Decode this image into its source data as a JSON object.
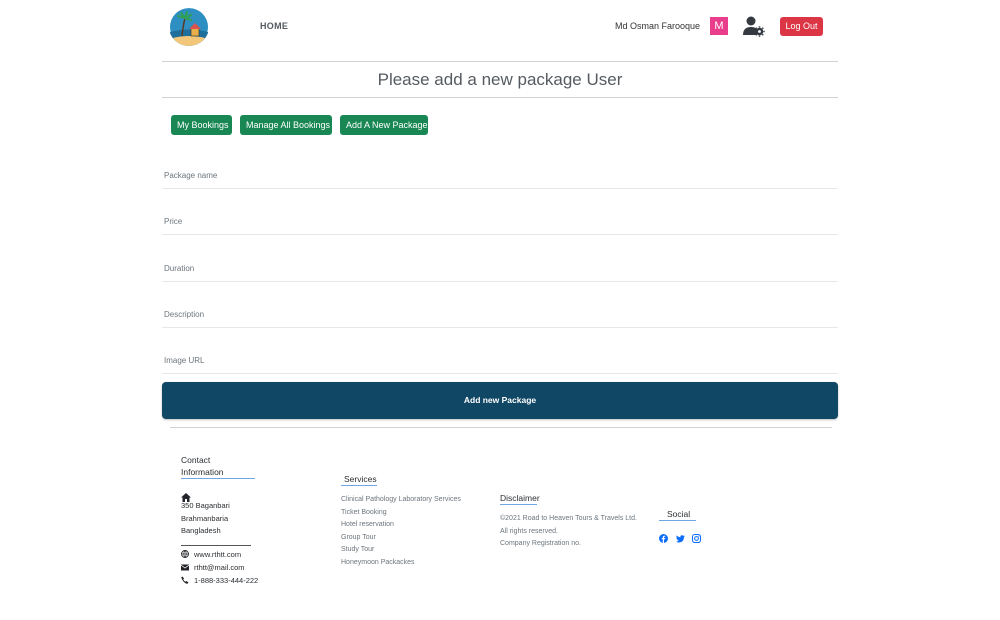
{
  "navbar": {
    "home_label": "HOME",
    "user_name": "Md Osman Farooque",
    "avatar_letter": "M",
    "logout_label": "Log Out"
  },
  "page": {
    "title": "Please add a new package User"
  },
  "dashboard_buttons": {
    "my_bookings": "My Bookings",
    "manage_all_bookings": "Manage All Bookings",
    "add_new_package": "Add A New Package"
  },
  "form": {
    "package_name_placeholder": "Package name",
    "price_placeholder": "Price",
    "duration_placeholder": "Duration",
    "description_placeholder": "Description",
    "image_url_placeholder": "Image URL",
    "submit_label": "Add new Package"
  },
  "footer": {
    "contact": {
      "heading_line1": "Contact",
      "heading_line2": "Information",
      "address_line1": "350 Baganbari",
      "address_line2": "Brahmanbaria",
      "address_line3": "Bangladesh",
      "website": "www.rthtt.com",
      "email": "rthtt@mail.com",
      "phone": "1-888-333-444-222"
    },
    "services": {
      "heading": "Services",
      "items": [
        "Clinical Pathology Laboratory Services",
        "Ticket Booking",
        "Hotel reservation",
        "Group Tour",
        "Study Tour",
        "Honeymoon Packackes"
      ]
    },
    "disclaimer": {
      "heading": "Disclaimer",
      "line1": "©2021 Road to Heaven Tours & Travels Ltd.",
      "line2": "All rights reserved.",
      "line3": "Company Registration no."
    },
    "social": {
      "heading": "Social",
      "icons": [
        "facebook-icon",
        "twitter-icon",
        "instagram-icon"
      ],
      "icon_color": "#0d6efd"
    }
  },
  "colors": {
    "primary_dark": "#0f4764",
    "success": "#198754",
    "danger": "#dc3545",
    "avatar": "#e83e8c",
    "accent_line": "#6fa7e6"
  }
}
